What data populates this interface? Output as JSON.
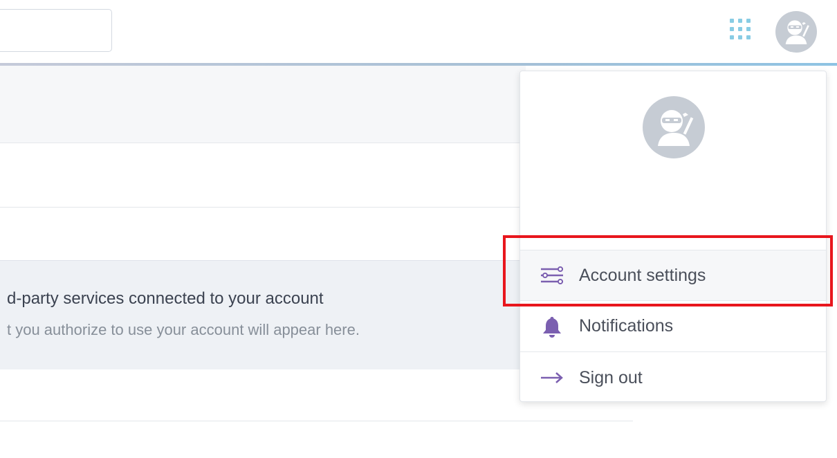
{
  "topbar": {
    "search": {
      "value": "",
      "placeholder": ""
    },
    "apps_icon": "grid-dots-icon",
    "avatar_icon": "ninja-avatar-icon",
    "colors": {
      "apps_dots": "#88cce4",
      "avatar_bg": "#c6ccd4",
      "border_accent": "#8ec3e3"
    }
  },
  "content": {
    "connected_services": {
      "title": "d-party services connected to your account",
      "description": "t you authorize to use your account will appear here."
    }
  },
  "user_menu": {
    "avatar_icon": "ninja-avatar-icon",
    "items": [
      {
        "label": "Account settings",
        "icon": "sliders-icon"
      },
      {
        "label": "Notifications",
        "icon": "bell-icon"
      },
      {
        "label": "Sign out",
        "icon": "arrow-right-icon"
      }
    ],
    "colors": {
      "icon": "#7b5fb0"
    }
  },
  "annotation": {
    "highlight_color": "#e8161d",
    "highlighted_item": "Account settings"
  }
}
